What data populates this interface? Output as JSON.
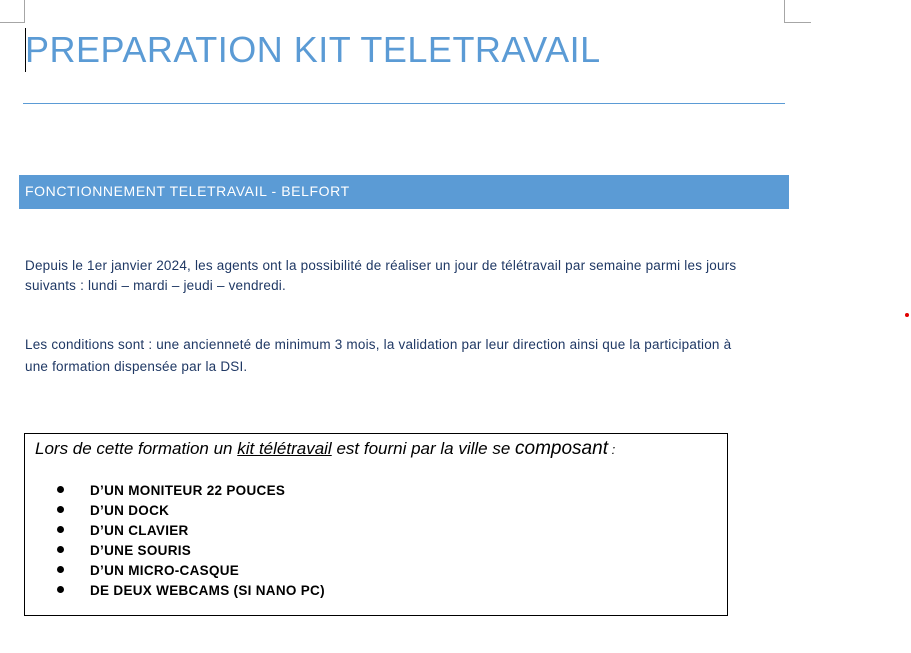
{
  "document": {
    "title": "PREPARATION KIT TELETRAVAIL",
    "section_header": "FONCTIONNEMENT TELETRAVAIL - BELFORT",
    "paragraph_1": "Depuis le 1er janvier 2024, les agents ont la possibilité de réaliser un jour de télétravail par semaine parmi les jours suivants : lundi – mardi – jeudi – vendredi.",
    "paragraph_2": "Les conditions sont : une ancienneté de minimum 3 mois, la validation par leur direction ainsi que la participation à une formation dispensée par la DSI.",
    "kit_box": {
      "intro_part_1": "Lors de cette formation un ",
      "intro_underlined": "kit télétravail",
      "intro_part_2": " est fourni par la ville se ",
      "intro_big": "composant",
      "intro_colon": " :",
      "items": [
        "D’UN MONITEUR 22 POUCES",
        "D’UN DOCK",
        "D’UN CLAVIER",
        "D’UNE SOURIS",
        "D’UN MICRO-CASQUE",
        "DE DEUX WEBCAMS (SI NANO PC)"
      ]
    },
    "colors": {
      "accent": "#5b9bd5",
      "body_text": "#1f3864",
      "header_text": "#ffffff"
    }
  }
}
